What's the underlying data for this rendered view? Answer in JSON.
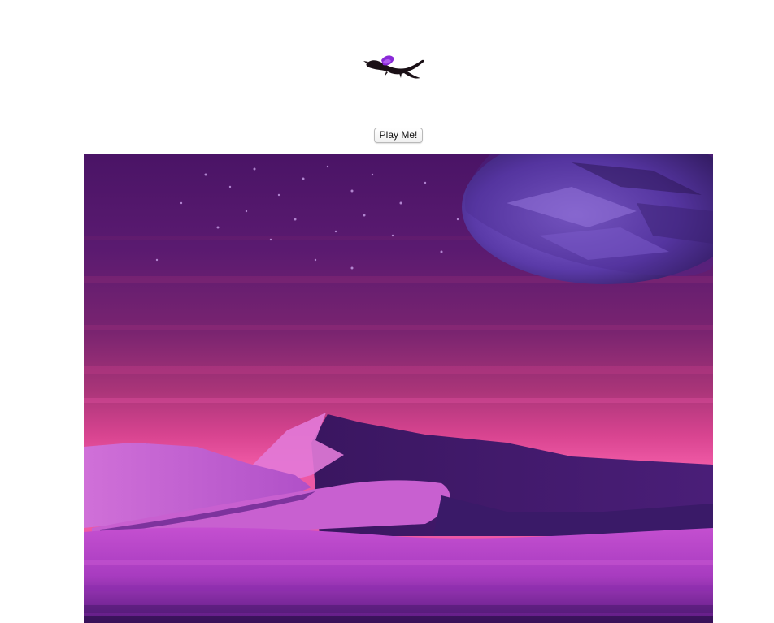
{
  "game": {
    "play_button_label": "Play Me!",
    "logo_icon": "dragon-icon",
    "scene": "purple-desert-night",
    "colors": {
      "sky_top": "#4a1466",
      "sky_horizon": "#e0489a",
      "dune_light": "#c44fd0",
      "dune_dark": "#3a1660",
      "planet": "#6a48b8"
    }
  }
}
